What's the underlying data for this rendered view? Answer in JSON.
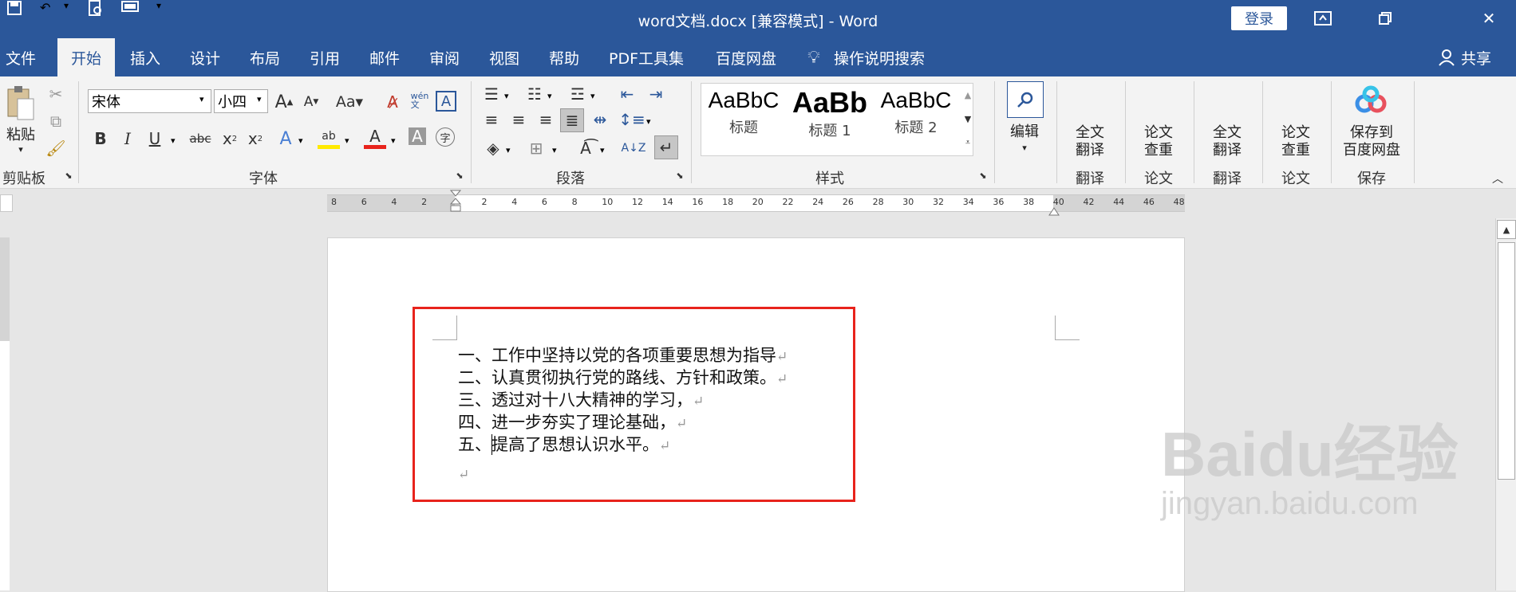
{
  "titlebar": {
    "title": "word文档.docx [兼容模式]  -  Word",
    "login": "登录",
    "quick_access": [
      "save-icon",
      "undo-icon",
      "print-preview-icon",
      "view-icon",
      "customize-icon"
    ]
  },
  "tabs": [
    "文件",
    "开始",
    "插入",
    "设计",
    "布局",
    "引用",
    "邮件",
    "审阅",
    "视图",
    "帮助",
    "PDF工具集",
    "百度网盘"
  ],
  "active_tab": "开始",
  "tell_me": "操作说明搜索",
  "share": "共享",
  "ribbon": {
    "clipboard": {
      "paste": "粘贴",
      "label": "剪贴板"
    },
    "font": {
      "name": "宋体",
      "size": "小四",
      "label": "字体",
      "phonetic": "wén\n文"
    },
    "paragraph": {
      "label": "段落"
    },
    "styles": {
      "label": "样式",
      "items": [
        {
          "preview": "AaBbC",
          "name": "标题"
        },
        {
          "preview": "AaBb",
          "name": "标题 1"
        },
        {
          "preview": "AaBbC",
          "name": "标题 2"
        }
      ]
    },
    "edit": {
      "label": "编辑"
    },
    "extras": [
      {
        "line1": "全文",
        "line2": "翻译",
        "group": "翻译"
      },
      {
        "line1": "论文",
        "line2": "查重",
        "group": "论文"
      },
      {
        "line1": "全文",
        "line2": "翻译",
        "group": "翻译"
      },
      {
        "line1": "论文",
        "line2": "查重",
        "group": "论文"
      },
      {
        "line1": "保存到",
        "line2": "百度网盘",
        "group": "保存"
      }
    ]
  },
  "ruler_ticks": [
    "8",
    "6",
    "4",
    "2",
    "",
    "2",
    "4",
    "6",
    "8",
    "10",
    "12",
    "14",
    "16",
    "18",
    "20",
    "22",
    "24",
    "26",
    "28",
    "30",
    "32",
    "34",
    "36",
    "38",
    "40",
    "42",
    "44",
    "46",
    "48"
  ],
  "document": {
    "lines": [
      "一、工作中坚持以党的各项重要思想为指导",
      "二、认真贯彻执行党的路线、方针和政策。",
      "三、透过对十八大精神的学习，",
      "四、进一步夯实了理论基础，",
      "五、提高了思想认识水平。"
    ],
    "para_mark": "↵"
  },
  "watermark": {
    "brand": "Baidu经验",
    "url": "jingyan.baidu.com"
  }
}
